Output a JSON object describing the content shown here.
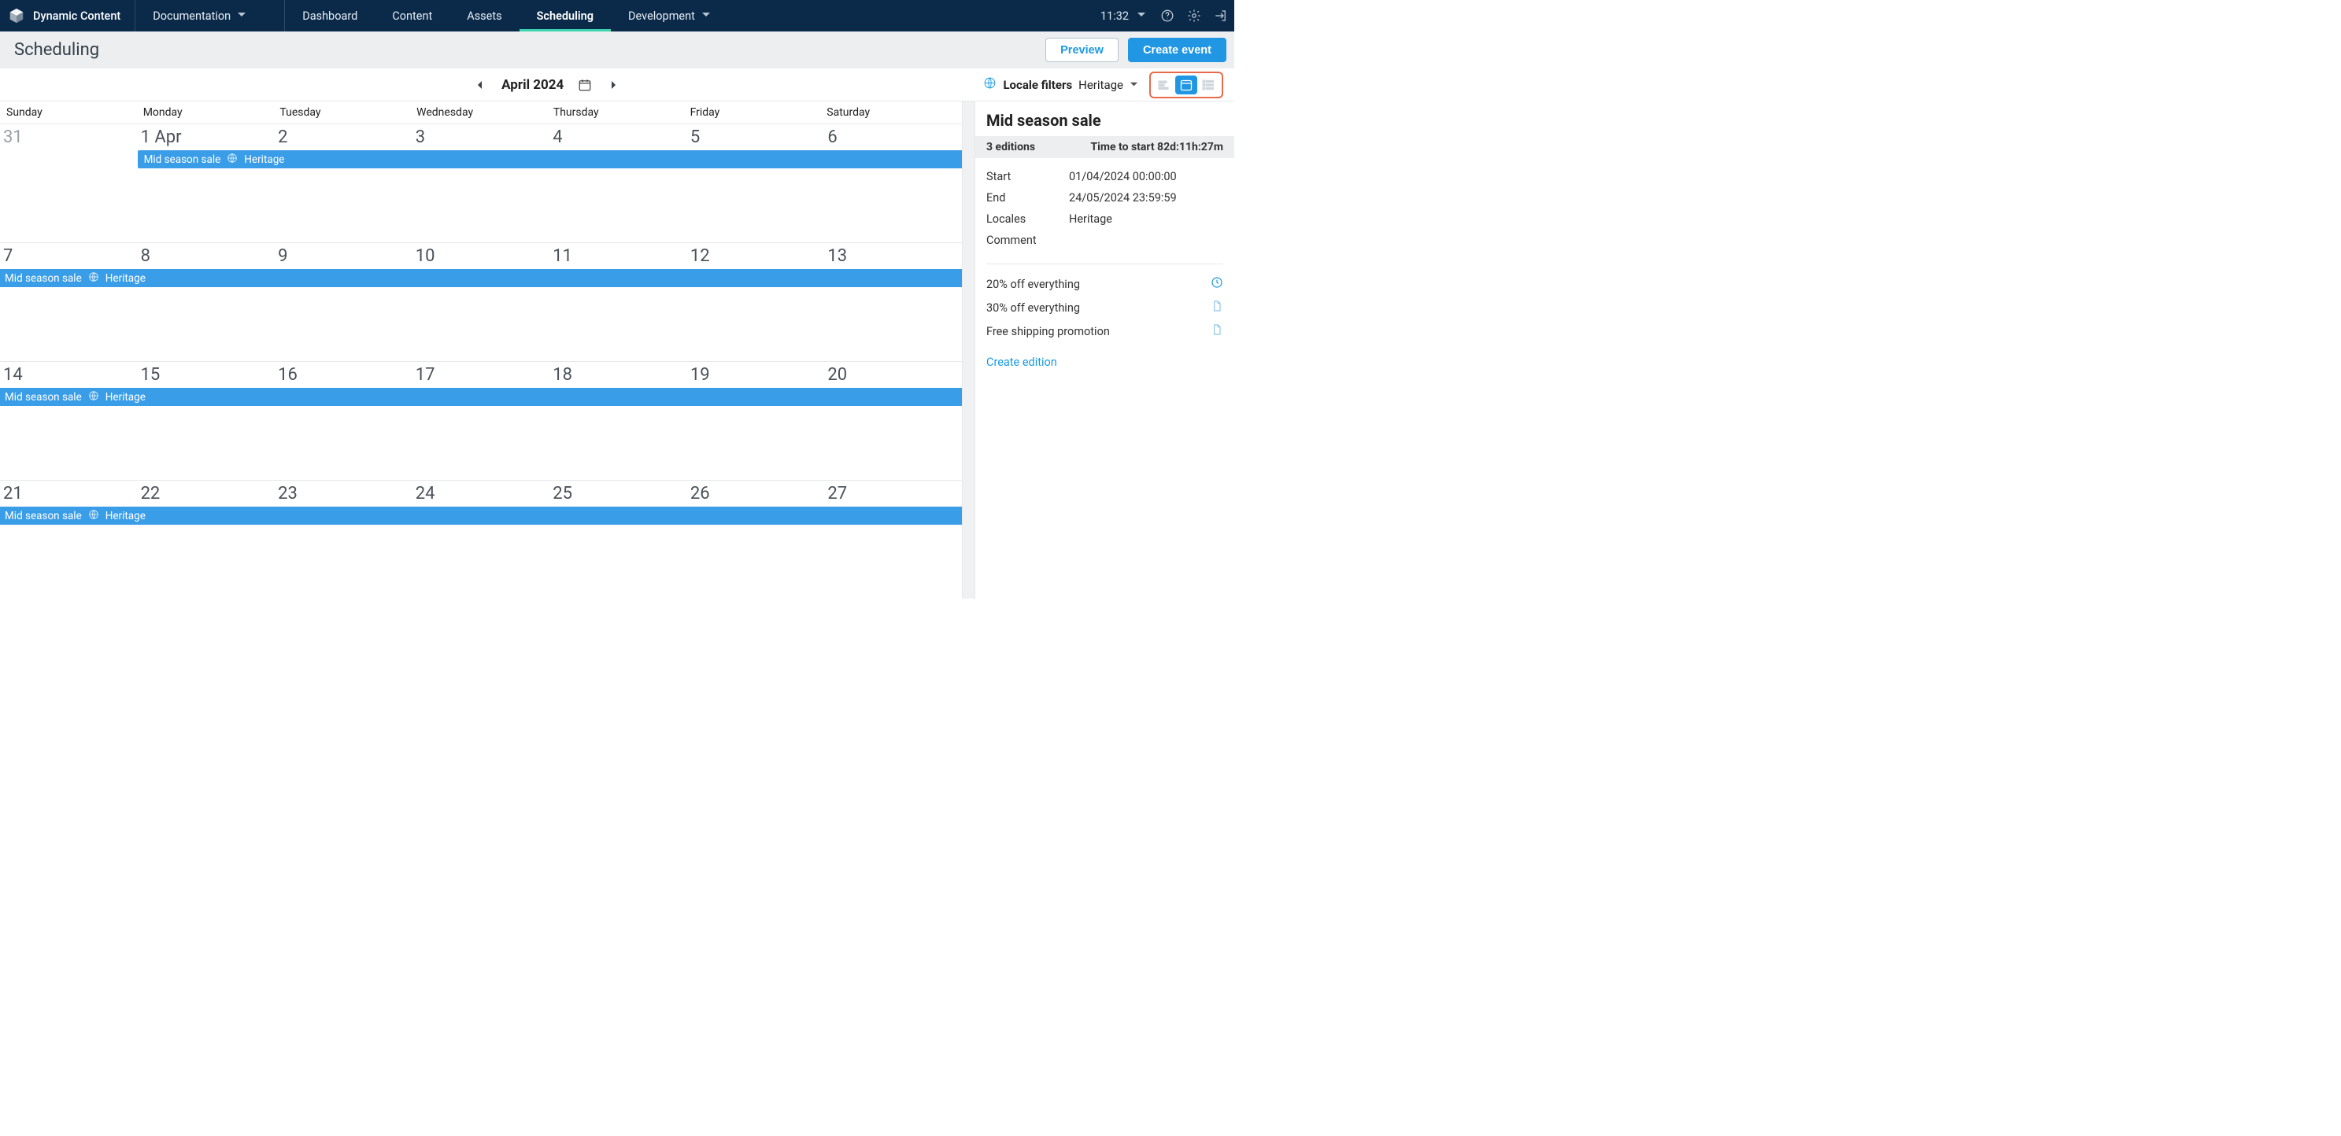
{
  "top": {
    "brand": "Dynamic Content",
    "nav": {
      "documentation": "Documentation",
      "dashboard": "Dashboard",
      "content": "Content",
      "assets": "Assets",
      "scheduling": "Scheduling",
      "development": "Development"
    },
    "clock": "11:32"
  },
  "subheader": {
    "title": "Scheduling",
    "preview": "Preview",
    "create_event": "Create event"
  },
  "toolbar": {
    "month_label": "April 2024",
    "locale_filters_label": "Locale filters",
    "locale_value": "Heritage"
  },
  "calendar": {
    "day_headers": [
      "Sunday",
      "Monday",
      "Tuesday",
      "Wednesday",
      "Thursday",
      "Friday",
      "Saturday"
    ],
    "weeks": [
      {
        "days": [
          "31",
          "1 Apr",
          "2",
          "3",
          "4",
          "5",
          "6"
        ],
        "muted": [
          true,
          false,
          false,
          false,
          false,
          false,
          false
        ],
        "event": {
          "title": "Mid season sale",
          "locale": "Heritage",
          "start_col": 1,
          "continue_left": false
        }
      },
      {
        "days": [
          "7",
          "8",
          "9",
          "10",
          "11",
          "12",
          "13"
        ],
        "muted": [
          false,
          false,
          false,
          false,
          false,
          false,
          false
        ],
        "event": {
          "title": "Mid season sale",
          "locale": "Heritage",
          "start_col": 0,
          "continue_left": true
        }
      },
      {
        "days": [
          "14",
          "15",
          "16",
          "17",
          "18",
          "19",
          "20"
        ],
        "muted": [
          false,
          false,
          false,
          false,
          false,
          false,
          false
        ],
        "event": {
          "title": "Mid season sale",
          "locale": "Heritage",
          "start_col": 0,
          "continue_left": true
        }
      },
      {
        "days": [
          "21",
          "22",
          "23",
          "24",
          "25",
          "26",
          "27"
        ],
        "muted": [
          false,
          false,
          false,
          false,
          false,
          false,
          false
        ],
        "event": {
          "title": "Mid season sale",
          "locale": "Heritage",
          "start_col": 0,
          "continue_left": true
        }
      }
    ]
  },
  "side": {
    "title": "Mid season sale",
    "summary": {
      "left": "3 editions",
      "right": "Time to start 82d:11h:27m"
    },
    "meta": {
      "start_k": "Start",
      "start_v": "01/04/2024 00:00:00",
      "end_k": "End",
      "end_v": "24/05/2024 23:59:59",
      "locales_k": "Locales",
      "locales_v": "Heritage",
      "comment_k": "Comment",
      "comment_v": ""
    },
    "editions": [
      {
        "name": "20% off everything",
        "icon": "clock"
      },
      {
        "name": "30% off everything",
        "icon": "page"
      },
      {
        "name": "Free shipping promotion",
        "icon": "page"
      }
    ],
    "create_edition": "Create edition"
  }
}
